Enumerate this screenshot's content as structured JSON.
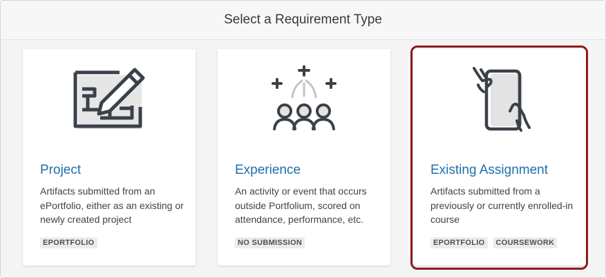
{
  "dialog": {
    "title": "Select a Requirement Type"
  },
  "cards": [
    {
      "title": "Project",
      "description": "Artifacts submitted from an ePortfolio, either as an existing or newly created project",
      "tags": [
        "EPORTFOLIO"
      ],
      "icon": "project-canvas-pencil-icon"
    },
    {
      "title": "Experience",
      "description": "An activity or event that occurs outside Portfolium, scored on attendance, performance, etc.",
      "tags": [
        "NO SUBMISSION"
      ],
      "icon": "people-group-plus-icon"
    },
    {
      "title": "Existing Assignment",
      "description": "Artifacts submitted from a previously or currently enrolled-in course",
      "tags": [
        "EPORTFOLIO",
        "COURSEWORK"
      ],
      "icon": "hands-holding-tablet-icon",
      "selected": true
    }
  ],
  "colors": {
    "accent": "#1d6faa",
    "selected_outline": "#8b1a1a",
    "icon_stroke": "#3a4149"
  }
}
